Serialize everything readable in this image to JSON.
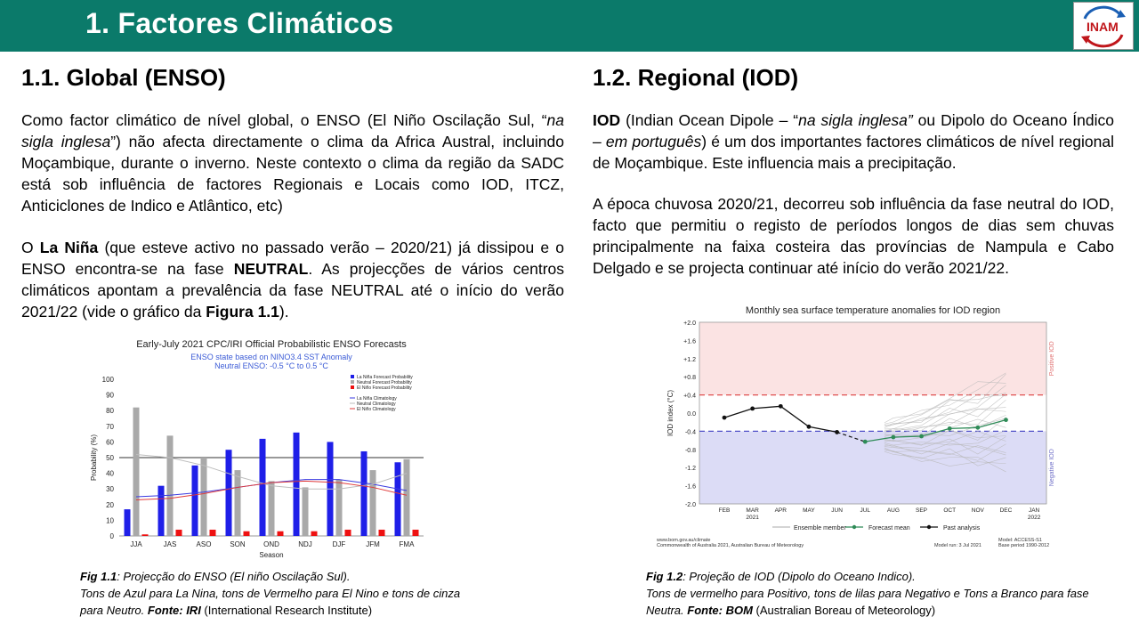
{
  "header": {
    "title": "1. Factores Climáticos",
    "logo_text": "INAM"
  },
  "left": {
    "heading": "1.1.  Global (ENSO)",
    "p1": {
      "a": "Como factor climático de nível global, o ENSO (El Niño Oscilação Sul, “",
      "a_em": "na sigla inglesa",
      "b": "”) não afecta directamente o clima da Africa Austral, incluindo Moçambique,  durante o inverno. Neste contexto o clima da região da SADC está sob influência de factores Regionais e Locais como IOD, ITCZ, Anticiclones de Indico e Atlântico, etc)"
    },
    "p2": {
      "a": "O ",
      "b1": "La Niña",
      "b": " (que esteve activo no passado verão – 2020/21) já dissipou e o ENSO encontra-se na fase ",
      "b2": "NEUTRAL",
      "c": ". As projecções de vários centros climáticos apontam a prevalência da fase NEUTRAL até o início do verão 2021/22 (vide o gráfico da ",
      "b3": "Figura 1.1",
      "d": ")."
    },
    "caption": {
      "fig": "Fig 1.1",
      "t1": ": Projecção do ENSO (El niño Oscilação Sul).",
      "t2": "Tons de Azul para La Nina, tons de Vermelho para El Nino e tons de cinza para Neutro. ",
      "fonte": "Fonte: IRI",
      "t3": " (International Research Institute)"
    }
  },
  "right": {
    "heading": "1.2. Regional (IOD)",
    "p1": {
      "b1": "IOD",
      "a": " (Indian Ocean Dipole – “",
      "a_em": "na sigla inglesa”",
      "b": " ou Dipolo do Oceano Índico – ",
      "b_em": "em português",
      "c": ") é um dos importantes factores climáticos de nível regional de Moçambique. Este influencia mais a precipitação."
    },
    "p2": "A época chuvosa 2020/21, decorreu sob influência da fase neutral do IOD, facto que permitiu o registo de períodos longos de dias sem chuvas principalmente na faixa costeira das províncias de Nampula e Cabo Delgado e se projecta continuar até início do verão 2021/22.",
    "caption": {
      "fig": "Fig 1.2",
      "t1": ": Projeção de IOD (Dipolo do Oceano Indico).",
      "t2": "Tons de vermelho para Positivo, tons de lilas para Negativo e Tons a Branco para fase Neutra. ",
      "fonte": "Fonte: BOM",
      "t3": " (Australian Boreau of Meteorology)"
    }
  },
  "chart_data": [
    {
      "type": "bar",
      "title": "Early-July 2021 CPC/IRI Official Probabilistic ENSO Forecasts",
      "subtitle1": "ENSO state based on NINO3.4 SST Anomaly",
      "subtitle2": "Neutral ENSO: -0.5 °C to 0.5 °C",
      "xlabel": "Season",
      "ylabel": "Probability (%)",
      "ylim": [
        0,
        100
      ],
      "yticks": [
        "0",
        "10",
        "20",
        "30",
        "40",
        "50",
        "60",
        "70",
        "80",
        "90",
        "100"
      ],
      "categories": [
        "JJA",
        "JAS",
        "ASO",
        "SON",
        "OND",
        "NDJ",
        "DJF",
        "JFM",
        "FMA"
      ],
      "series": [
        {
          "name": "La Niña Forecast Probability",
          "color": "#1f1fe8",
          "values": [
            17,
            32,
            45,
            55,
            62,
            66,
            60,
            54,
            47
          ]
        },
        {
          "name": "Neutral Forecast Probability",
          "color": "#a9a9a9",
          "values": [
            82,
            64,
            50,
            42,
            35,
            31,
            36,
            42,
            49
          ]
        },
        {
          "name": "El Niño Forecast Probability",
          "color": "#ee1111",
          "values": [
            1,
            4,
            4,
            3,
            3,
            3,
            4,
            4,
            4
          ]
        }
      ],
      "climatology": [
        {
          "name": "La Niña Climatology",
          "color": "#3a3ae0",
          "values": [
            25,
            26,
            28,
            31,
            34,
            36,
            36,
            33,
            29
          ]
        },
        {
          "name": "Neutral Climatology",
          "color": "#bdbdbd",
          "values": [
            52,
            50,
            45,
            38,
            32,
            30,
            30,
            33,
            40
          ]
        },
        {
          "name": "El Niño Climatology",
          "color": "#e03a3a",
          "values": [
            23,
            24,
            27,
            31,
            34,
            35,
            34,
            31,
            26
          ]
        }
      ]
    },
    {
      "type": "line",
      "title": "Monthly sea surface temperature anomalies for IOD region",
      "ylabel": "IOD index (°C)",
      "ylim": [
        -2.0,
        2.0
      ],
      "yticks": [
        "+2.0",
        "+1.6",
        "+1.2",
        "+0.8",
        "+0.4",
        "0.0",
        "-0.4",
        "-0.8",
        "-1.2",
        "-1.6",
        "-2.0"
      ],
      "months": [
        "FEB",
        "MAR",
        "APR",
        "MAY",
        "JUN",
        "JUL",
        "AUG",
        "SEP",
        "OCT",
        "NOV",
        "DEC",
        "JAN"
      ],
      "month_sublabels": {
        "MAR": "2021",
        "JAN": "2022"
      },
      "thresholds": [
        0.4,
        -0.4
      ],
      "positive_label": "Positive IOD",
      "negative_label": "Negative IOD",
      "past_analysis": {
        "name": "Past analysis",
        "months": [
          "FEB",
          "MAR",
          "APR",
          "MAY",
          "JUN"
        ],
        "values": [
          -0.1,
          0.1,
          0.15,
          -0.3,
          -0.42
        ]
      },
      "forecast_mean": {
        "name": "Forecast mean",
        "months": [
          "JUL",
          "AUG",
          "SEP",
          "OCT",
          "NOV",
          "DEC"
        ],
        "values": [
          -0.63,
          -0.53,
          -0.51,
          -0.34,
          -0.32,
          -0.15
        ]
      },
      "ensemble_label": "Ensemble member",
      "footer_left1": "www.bom.gov.au/climate",
      "footer_left2": "Commonwealth of Australia 2021, Australian Bureau of Meteorology",
      "footer_mid": "Model run: 3 Jul 2021",
      "footer_right1": "Model: ACCESS-S1",
      "footer_right2": "Base period 1990-2012"
    }
  ]
}
